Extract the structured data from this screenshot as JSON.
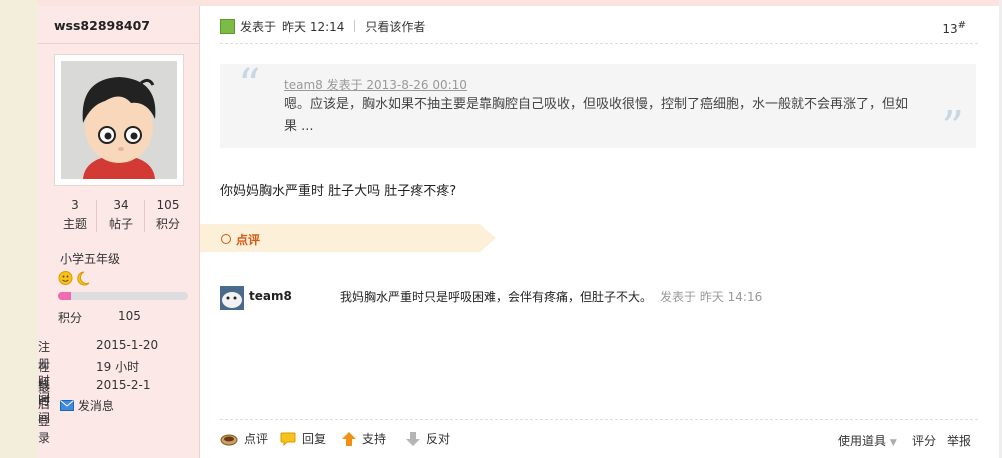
{
  "author": {
    "username": "wss82898407",
    "stats": [
      {
        "value": "3",
        "label": "主题"
      },
      {
        "value": "34",
        "label": "帖子"
      },
      {
        "value": "105",
        "label": "积分"
      }
    ],
    "rank": "小学五年级",
    "progress_fraction": 0.1,
    "points_label": "积分",
    "points_value": "105",
    "info": [
      {
        "key": "注册时间",
        "value": "2015-1-20"
      },
      {
        "key": "在线时间",
        "value": "19 小时"
      },
      {
        "key": "最后登录",
        "value": "2015-2-1"
      }
    ],
    "send_message": "发消息"
  },
  "post": {
    "posted_label": "发表于",
    "posted_time": "昨天 12:14",
    "only_author": "只看该作者",
    "floor_number": "13",
    "floor_suffix": "#",
    "quote": {
      "header": "team8 发表于 2013-8-26 00:10",
      "body": "嗯。应该是，胸水如果不抽主要是靠胸腔自己吸收，但吸收很慢，控制了癌细胞，水一般就不会再涨了，但如果 ..."
    },
    "content": "你妈妈胸水严重时  肚子大吗  肚子疼不疼?"
  },
  "comments": {
    "section_label": "点评",
    "items": [
      {
        "user": "team8",
        "text": "我妈胸水严重时只是呼吸困难，会伴有疼痛，但肚子不大。",
        "meta": "发表于  昨天 14:16"
      }
    ]
  },
  "footer": {
    "comment": "点评",
    "reply": "回复",
    "support": "支持",
    "oppose": "反对",
    "tools": "使用道具",
    "rate": "评分",
    "report": "举报"
  },
  "colors": {
    "sidebar_bg": "#fde8e8",
    "progress": "#f06cb2",
    "comment_accent": "#d35a19",
    "page_bg": "#f3eddc"
  }
}
